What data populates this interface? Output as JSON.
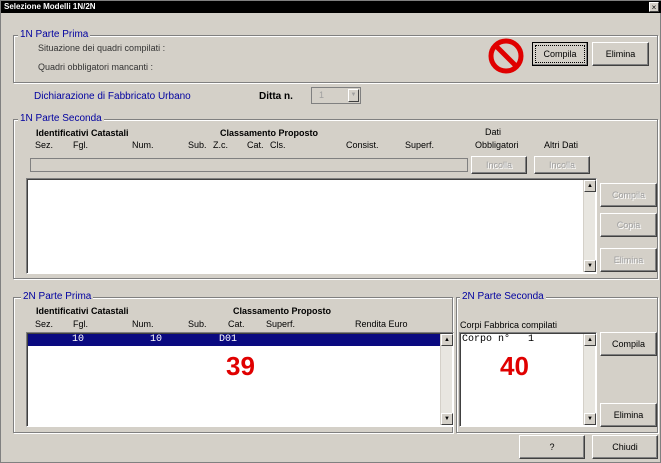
{
  "window": {
    "title": "Selezione Modelli 1N/2N",
    "close": "×"
  },
  "part1n_prima": {
    "label": "1N Parte Prima",
    "situazione_label": "Situazione dei quadri compilati :",
    "obbligatori_label": "Quadri obbligatori mancanti :",
    "compila": "Compila",
    "elimina": "Elimina"
  },
  "dichiarazione": {
    "label": "Dichiarazione di Fabbricato Urbano",
    "ditta_label": "Ditta n.",
    "ditta_value": "1"
  },
  "part1n_seconda": {
    "label": "1N Parte Seconda",
    "hdr_identificativi": "Identificativi Catastali",
    "hdr_classamento": "Classamento Proposto",
    "hdr_dati": "Dati",
    "cols": [
      "Sez.",
      "Fgl.",
      "Num.",
      "Sub.",
      "Z.c.",
      "Cat.",
      "Cls.",
      "Consist.",
      "Superf.",
      "Obbligatori",
      "Altri Dati"
    ],
    "incolla1": "Incolla",
    "incolla2": "Incolla",
    "compila": "Compila",
    "copia": "Copia",
    "elimina": "Elimina"
  },
  "part2n_prima": {
    "label": "2N Parte Prima",
    "hdr_identificativi": "Identificativi Catastali",
    "hdr_classamento": "Classamento Proposto",
    "cols": [
      "Sez.",
      "Fgl.",
      "Num.",
      "Sub.",
      "Cat.",
      "Superf.",
      "Rendita Euro"
    ],
    "rows": [
      {
        "fgl": "10",
        "num": "10",
        "cat": "D01"
      }
    ],
    "annotation": "39"
  },
  "part2n_seconda": {
    "label": "2N Parte Seconda",
    "corpi_label": "Corpi Fabbrica compilati",
    "items": [
      "Corpo n°   1"
    ],
    "compila": "Compila",
    "elimina": "Elimina",
    "annotation": "40"
  },
  "footer": {
    "help": "?",
    "chiudi": "Chiudi"
  },
  "colors": {
    "selection": "#0a0a80",
    "annotation": "#e00000",
    "groupLabel": "#0000a0"
  }
}
